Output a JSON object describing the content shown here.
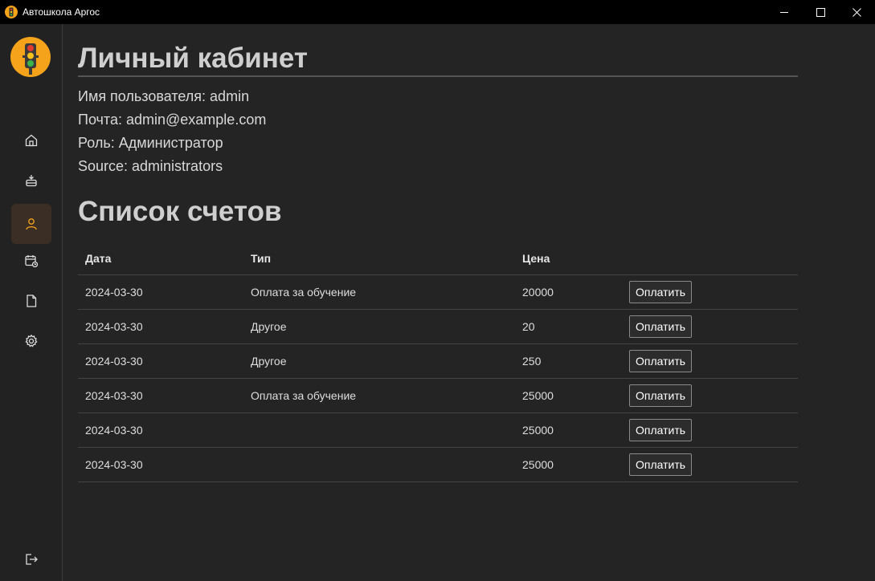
{
  "window": {
    "title": "Автошкола Аргос"
  },
  "profile": {
    "heading": "Личный кабинет",
    "username": "Имя пользователя: admin",
    "email": "Почта: admin@example.com",
    "role": "Роль: Администратор",
    "source": "Source: administrators"
  },
  "invoices": {
    "heading": "Список счетов",
    "columns": {
      "date": "Дата",
      "type": "Тип",
      "price": "Цена"
    },
    "pay_label": "Оплатить",
    "rows": [
      {
        "date": "2024-03-30",
        "type": "Оплата за обучение",
        "price": "20000"
      },
      {
        "date": "2024-03-30",
        "type": "Другое",
        "price": "20"
      },
      {
        "date": "2024-03-30",
        "type": "Другое",
        "price": "250"
      },
      {
        "date": "2024-03-30",
        "type": "Оплата за обучение",
        "price": "25000"
      },
      {
        "date": "2024-03-30",
        "type": "",
        "price": "25000"
      },
      {
        "date": "2024-03-30",
        "type": "",
        "price": "25000"
      }
    ]
  },
  "sidebar": {
    "active_item": "profile",
    "accent_color": "#f4a31a",
    "active_bg": "#3b2f25",
    "items": [
      "home-icon",
      "exam-icon",
      "profile-icon",
      "schedule-icon",
      "document-icon",
      "settings-icon"
    ],
    "bottom_item": "logout-icon"
  }
}
